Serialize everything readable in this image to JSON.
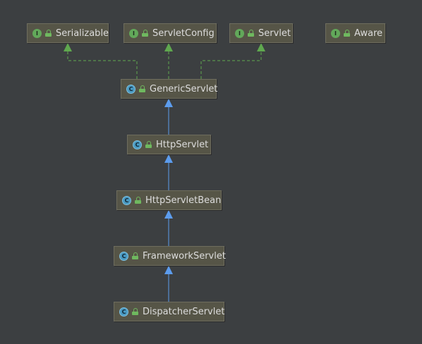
{
  "diagram": {
    "nodes": [
      {
        "id": "serializable",
        "label": "Serializable",
        "kind": "interface",
        "badge": "I"
      },
      {
        "id": "servletconfig",
        "label": "ServletConfig",
        "kind": "interface",
        "badge": "I"
      },
      {
        "id": "servlet",
        "label": "Servlet",
        "kind": "interface",
        "badge": "I"
      },
      {
        "id": "aware",
        "label": "Aware",
        "kind": "interface",
        "badge": "I"
      },
      {
        "id": "genericservlet",
        "label": "GenericServlet",
        "kind": "class",
        "badge": "C"
      },
      {
        "id": "httpservlet",
        "label": "HttpServlet",
        "kind": "class",
        "badge": "C"
      },
      {
        "id": "httpservletbean",
        "label": "HttpServletBean",
        "kind": "class",
        "badge": "C"
      },
      {
        "id": "frameworkservlet",
        "label": "FrameworkServlet",
        "kind": "class",
        "badge": "C"
      },
      {
        "id": "dispatcherservlet",
        "label": "DispatcherServlet",
        "kind": "class",
        "badge": "C"
      }
    ],
    "edges": [
      {
        "from": "genericservlet",
        "to": "serializable",
        "type": "implements"
      },
      {
        "from": "genericservlet",
        "to": "servletconfig",
        "type": "implements"
      },
      {
        "from": "genericservlet",
        "to": "servlet",
        "type": "implements"
      },
      {
        "from": "httpservlet",
        "to": "genericservlet",
        "type": "extends"
      },
      {
        "from": "httpservletbean",
        "to": "httpservlet",
        "type": "extends"
      },
      {
        "from": "frameworkservlet",
        "to": "httpservletbean",
        "type": "extends"
      },
      {
        "from": "dispatcherservlet",
        "to": "frameworkservlet",
        "type": "extends"
      }
    ],
    "colors": {
      "background": "#3c3f41",
      "node_fill": "#565547",
      "implements_edge": "#5fa84f",
      "extends_edge": "#5c9ced",
      "interface_badge": "#62a85a",
      "class_badge": "#4a9ac2"
    }
  }
}
